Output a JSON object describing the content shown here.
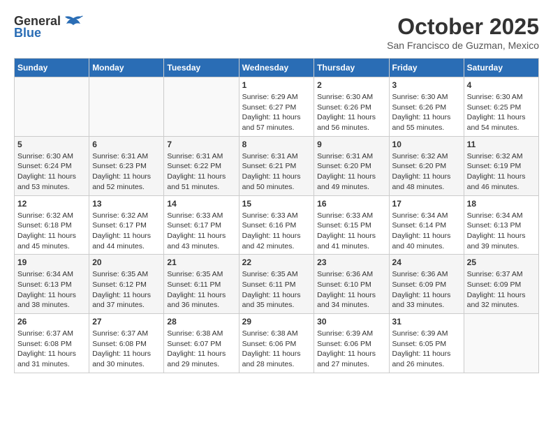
{
  "logo": {
    "general": "General",
    "blue": "Blue"
  },
  "title": "October 2025",
  "location": "San Francisco de Guzman, Mexico",
  "days_of_week": [
    "Sunday",
    "Monday",
    "Tuesday",
    "Wednesday",
    "Thursday",
    "Friday",
    "Saturday"
  ],
  "weeks": [
    [
      {
        "day": "",
        "info": ""
      },
      {
        "day": "",
        "info": ""
      },
      {
        "day": "",
        "info": ""
      },
      {
        "day": "1",
        "sunrise": "Sunrise: 6:29 AM",
        "sunset": "Sunset: 6:27 PM",
        "daylight": "Daylight: 11 hours and 57 minutes."
      },
      {
        "day": "2",
        "sunrise": "Sunrise: 6:30 AM",
        "sunset": "Sunset: 6:26 PM",
        "daylight": "Daylight: 11 hours and 56 minutes."
      },
      {
        "day": "3",
        "sunrise": "Sunrise: 6:30 AM",
        "sunset": "Sunset: 6:26 PM",
        "daylight": "Daylight: 11 hours and 55 minutes."
      },
      {
        "day": "4",
        "sunrise": "Sunrise: 6:30 AM",
        "sunset": "Sunset: 6:25 PM",
        "daylight": "Daylight: 11 hours and 54 minutes."
      }
    ],
    [
      {
        "day": "5",
        "sunrise": "Sunrise: 6:30 AM",
        "sunset": "Sunset: 6:24 PM",
        "daylight": "Daylight: 11 hours and 53 minutes."
      },
      {
        "day": "6",
        "sunrise": "Sunrise: 6:31 AM",
        "sunset": "Sunset: 6:23 PM",
        "daylight": "Daylight: 11 hours and 52 minutes."
      },
      {
        "day": "7",
        "sunrise": "Sunrise: 6:31 AM",
        "sunset": "Sunset: 6:22 PM",
        "daylight": "Daylight: 11 hours and 51 minutes."
      },
      {
        "day": "8",
        "sunrise": "Sunrise: 6:31 AM",
        "sunset": "Sunset: 6:21 PM",
        "daylight": "Daylight: 11 hours and 50 minutes."
      },
      {
        "day": "9",
        "sunrise": "Sunrise: 6:31 AM",
        "sunset": "Sunset: 6:20 PM",
        "daylight": "Daylight: 11 hours and 49 minutes."
      },
      {
        "day": "10",
        "sunrise": "Sunrise: 6:32 AM",
        "sunset": "Sunset: 6:20 PM",
        "daylight": "Daylight: 11 hours and 48 minutes."
      },
      {
        "day": "11",
        "sunrise": "Sunrise: 6:32 AM",
        "sunset": "Sunset: 6:19 PM",
        "daylight": "Daylight: 11 hours and 46 minutes."
      }
    ],
    [
      {
        "day": "12",
        "sunrise": "Sunrise: 6:32 AM",
        "sunset": "Sunset: 6:18 PM",
        "daylight": "Daylight: 11 hours and 45 minutes."
      },
      {
        "day": "13",
        "sunrise": "Sunrise: 6:32 AM",
        "sunset": "Sunset: 6:17 PM",
        "daylight": "Daylight: 11 hours and 44 minutes."
      },
      {
        "day": "14",
        "sunrise": "Sunrise: 6:33 AM",
        "sunset": "Sunset: 6:17 PM",
        "daylight": "Daylight: 11 hours and 43 minutes."
      },
      {
        "day": "15",
        "sunrise": "Sunrise: 6:33 AM",
        "sunset": "Sunset: 6:16 PM",
        "daylight": "Daylight: 11 hours and 42 minutes."
      },
      {
        "day": "16",
        "sunrise": "Sunrise: 6:33 AM",
        "sunset": "Sunset: 6:15 PM",
        "daylight": "Daylight: 11 hours and 41 minutes."
      },
      {
        "day": "17",
        "sunrise": "Sunrise: 6:34 AM",
        "sunset": "Sunset: 6:14 PM",
        "daylight": "Daylight: 11 hours and 40 minutes."
      },
      {
        "day": "18",
        "sunrise": "Sunrise: 6:34 AM",
        "sunset": "Sunset: 6:13 PM",
        "daylight": "Daylight: 11 hours and 39 minutes."
      }
    ],
    [
      {
        "day": "19",
        "sunrise": "Sunrise: 6:34 AM",
        "sunset": "Sunset: 6:13 PM",
        "daylight": "Daylight: 11 hours and 38 minutes."
      },
      {
        "day": "20",
        "sunrise": "Sunrise: 6:35 AM",
        "sunset": "Sunset: 6:12 PM",
        "daylight": "Daylight: 11 hours and 37 minutes."
      },
      {
        "day": "21",
        "sunrise": "Sunrise: 6:35 AM",
        "sunset": "Sunset: 6:11 PM",
        "daylight": "Daylight: 11 hours and 36 minutes."
      },
      {
        "day": "22",
        "sunrise": "Sunrise: 6:35 AM",
        "sunset": "Sunset: 6:11 PM",
        "daylight": "Daylight: 11 hours and 35 minutes."
      },
      {
        "day": "23",
        "sunrise": "Sunrise: 6:36 AM",
        "sunset": "Sunset: 6:10 PM",
        "daylight": "Daylight: 11 hours and 34 minutes."
      },
      {
        "day": "24",
        "sunrise": "Sunrise: 6:36 AM",
        "sunset": "Sunset: 6:09 PM",
        "daylight": "Daylight: 11 hours and 33 minutes."
      },
      {
        "day": "25",
        "sunrise": "Sunrise: 6:37 AM",
        "sunset": "Sunset: 6:09 PM",
        "daylight": "Daylight: 11 hours and 32 minutes."
      }
    ],
    [
      {
        "day": "26",
        "sunrise": "Sunrise: 6:37 AM",
        "sunset": "Sunset: 6:08 PM",
        "daylight": "Daylight: 11 hours and 31 minutes."
      },
      {
        "day": "27",
        "sunrise": "Sunrise: 6:37 AM",
        "sunset": "Sunset: 6:08 PM",
        "daylight": "Daylight: 11 hours and 30 minutes."
      },
      {
        "day": "28",
        "sunrise": "Sunrise: 6:38 AM",
        "sunset": "Sunset: 6:07 PM",
        "daylight": "Daylight: 11 hours and 29 minutes."
      },
      {
        "day": "29",
        "sunrise": "Sunrise: 6:38 AM",
        "sunset": "Sunset: 6:06 PM",
        "daylight": "Daylight: 11 hours and 28 minutes."
      },
      {
        "day": "30",
        "sunrise": "Sunrise: 6:39 AM",
        "sunset": "Sunset: 6:06 PM",
        "daylight": "Daylight: 11 hours and 27 minutes."
      },
      {
        "day": "31",
        "sunrise": "Sunrise: 6:39 AM",
        "sunset": "Sunset: 6:05 PM",
        "daylight": "Daylight: 11 hours and 26 minutes."
      },
      {
        "day": "",
        "info": ""
      }
    ]
  ]
}
